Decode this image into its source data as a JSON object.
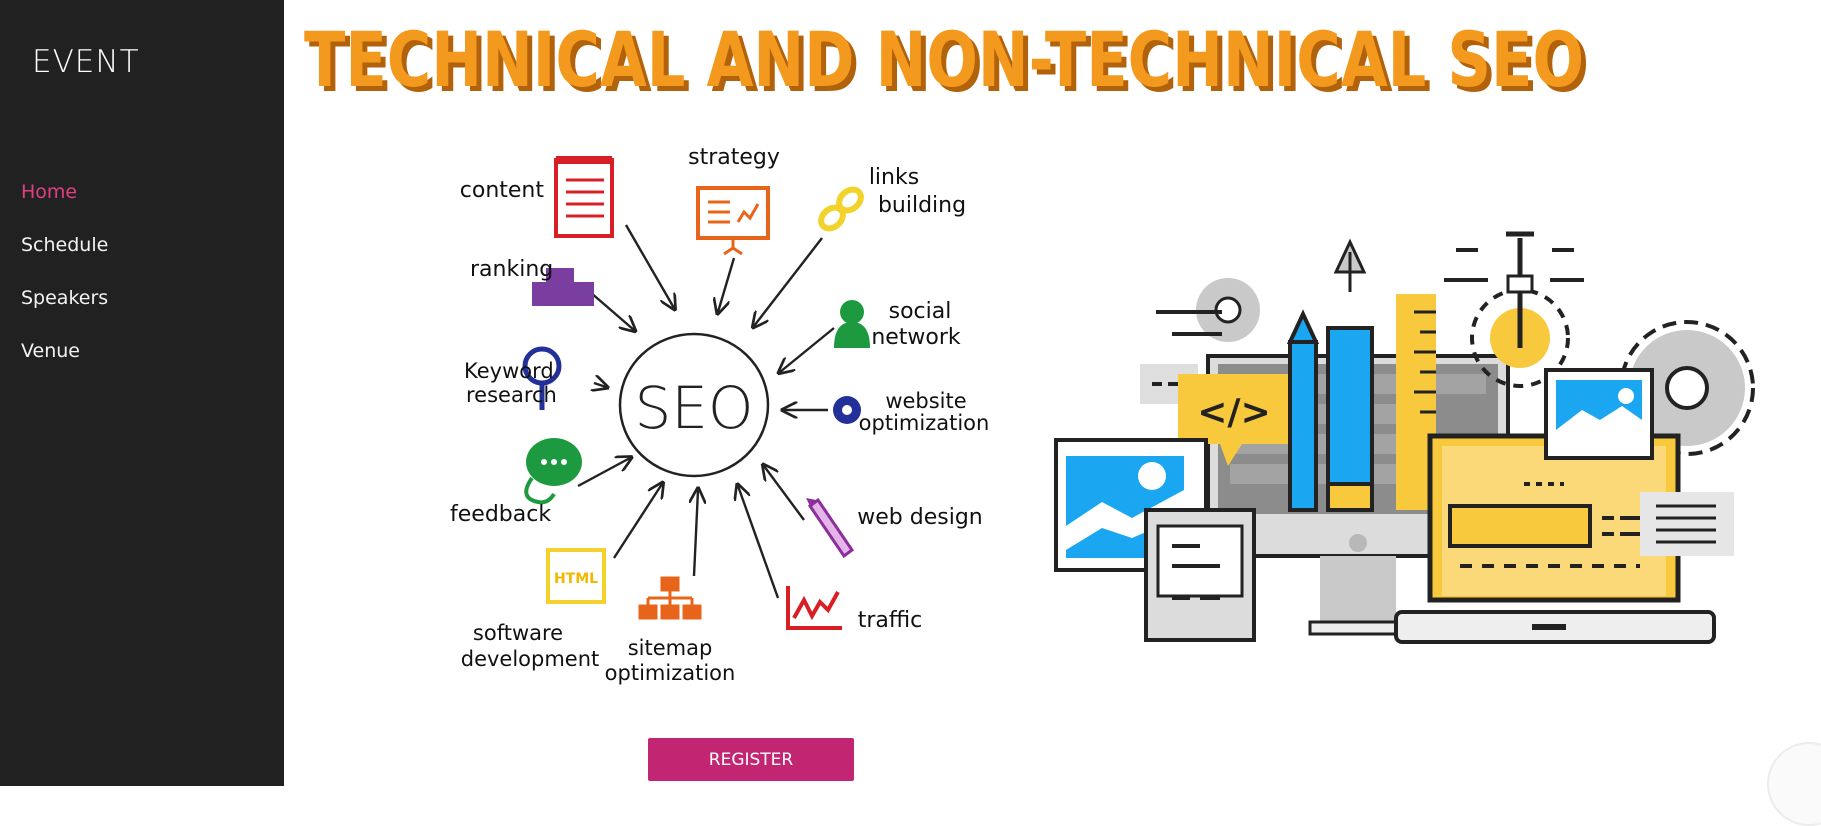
{
  "brand": {
    "name": "EVENT"
  },
  "nav": {
    "items": [
      {
        "label": "Home",
        "active": true
      },
      {
        "label": "Schedule",
        "active": false
      },
      {
        "label": "Speakers",
        "active": false
      },
      {
        "label": "Venue",
        "active": false
      }
    ]
  },
  "hero": {
    "title": "TECHNICAL AND NON-TECHNICAL SEO",
    "center_label": "SEO",
    "spokes": {
      "content": "content",
      "strategy": "strategy",
      "links_1": "links",
      "links_2": "building",
      "ranking": "ranking",
      "social_1": "social",
      "social_2": "network",
      "keyword_1": "Keyword",
      "keyword_2": "research",
      "website_1": "website",
      "website_2": "optimization",
      "feedback": "feedback",
      "web_design": "web design",
      "html_badge": "HTML",
      "software_1": "software",
      "software_2": "development",
      "sitemap_1": "sitemap",
      "sitemap_2": "optimization",
      "traffic": "traffic"
    },
    "code_symbol": "</>",
    "icons": [
      "notepad-icon",
      "presentation-board-icon",
      "chain-link-icon",
      "podium-icon",
      "person-icon",
      "magnifier-icon",
      "gear-icon",
      "speech-bubble-icon",
      "pencil-icon",
      "html-file-icon",
      "sitemap-icon",
      "line-chart-icon"
    ]
  },
  "actions": {
    "register_label": "REGISTER"
  },
  "colors": {
    "sidebar_bg": "#212121",
    "nav_active": "#e0407f",
    "button_bg": "#c22672",
    "title_orange": "#f39a1e",
    "accent_blue": "#1aa6f0",
    "accent_yellow": "#f8c93c"
  }
}
